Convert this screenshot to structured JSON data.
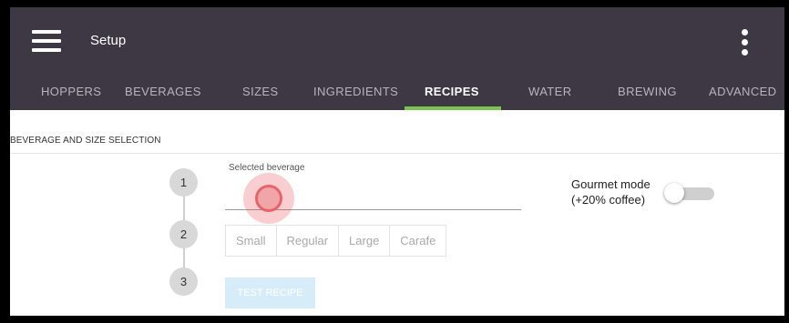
{
  "header": {
    "title": "Setup",
    "menu_icon": "hamburger-menu-icon",
    "overflow_icon": "more-vertical-icon"
  },
  "tabs": [
    {
      "label": "HOPPERS"
    },
    {
      "label": "BEVERAGES"
    },
    {
      "label": "SIZES"
    },
    {
      "label": "INGREDIENTS"
    },
    {
      "label": "RECIPES",
      "active": true
    },
    {
      "label": "WATER"
    },
    {
      "label": "BREWING"
    },
    {
      "label": "ADVANCED"
    }
  ],
  "section": {
    "title": "BEVERAGE AND SIZE SELECTION"
  },
  "steps": [
    "1",
    "2",
    "3"
  ],
  "beverage": {
    "label": "Selected beverage",
    "value": ""
  },
  "sizes": [
    "Small",
    "Regular",
    "Large",
    "Carafe"
  ],
  "test_recipe_label": "TEST RECIPE",
  "gourmet": {
    "line1": "Gourmet mode",
    "line2": "(+20% coffee)",
    "enabled": false
  },
  "colors": {
    "appbar": "#3d3844",
    "accent": "#7bc452",
    "disabled_button": "#d6ecf8"
  }
}
